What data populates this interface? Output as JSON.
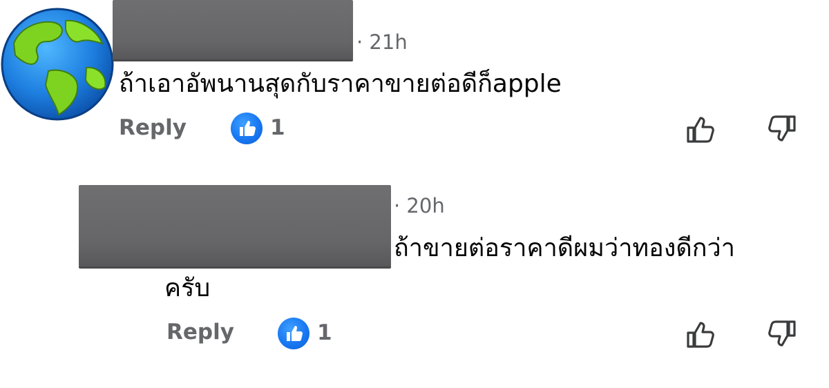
{
  "comments": [
    {
      "timestamp": "· 21h",
      "text": "ถ้าเอาอัพนานสุดกับราคาขายต่อดีก็apple",
      "reply_label": "Reply",
      "like_count": "1"
    },
    {
      "timestamp": "· 20h",
      "text_line1": "ถ้าขายต่อราคาดีผมว่าทองดีกว่า",
      "text_line2": "ครับ",
      "reply_label": "Reply",
      "like_count": "1"
    }
  ],
  "colors": {
    "like_blue": "#1877f2",
    "meta_gray": "#65676b",
    "redaction_gray": "#666668"
  },
  "icons": [
    "globe-avatar",
    "thumbs-up-badge-icon",
    "thumbs-up-outline-icon",
    "thumbs-down-outline-icon"
  ]
}
